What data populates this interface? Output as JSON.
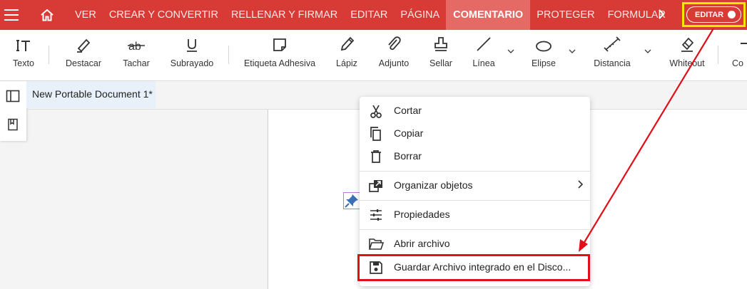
{
  "nav": {
    "items": [
      "VER",
      "CREAR Y CONVERTIR",
      "RELLENAR Y FIRMAR",
      "EDITAR",
      "PÁGINA",
      "COMENTARIO",
      "PROTEGER",
      "FORMULAR"
    ],
    "active": "COMENTARIO",
    "edit_toggle_label": "EDITAR",
    "colors": {
      "bar": "#d83a36",
      "active_tab": "#e56a66",
      "highlight": "#f3e600",
      "annotation": "#e0101a"
    }
  },
  "toolbar": {
    "tools": [
      {
        "label": "Texto",
        "icon": "text-tool-icon"
      },
      {
        "label": "Destacar",
        "icon": "highlighter-icon"
      },
      {
        "label": "Tachar",
        "icon": "strikethrough-icon"
      },
      {
        "label": "Subrayado",
        "icon": "underline-icon"
      },
      {
        "label": "Etiqueta Adhesiva",
        "icon": "sticky-note-icon"
      },
      {
        "label": "Lápiz",
        "icon": "pencil-icon"
      },
      {
        "label": "Adjunto",
        "icon": "paperclip-icon"
      },
      {
        "label": "Sellar",
        "icon": "stamp-icon"
      },
      {
        "label": "Línea",
        "icon": "line-icon"
      },
      {
        "label": "Elipse",
        "icon": "ellipse-icon"
      },
      {
        "label": "Distancia",
        "icon": "distance-icon"
      },
      {
        "label": "Whiteout",
        "icon": "eraser-icon"
      },
      {
        "label": "Co",
        "icon": "partial-tool-icon"
      }
    ]
  },
  "document": {
    "tab_title": "New Portable Document 1*"
  },
  "context_menu": {
    "items": [
      {
        "label": "Cortar",
        "icon": "scissors-icon"
      },
      {
        "label": "Copiar",
        "icon": "copy-icon"
      },
      {
        "label": "Borrar",
        "icon": "trash-icon"
      },
      {
        "label": "Organizar objetos",
        "icon": "arrange-objects-icon",
        "submenu": true
      },
      {
        "label": "Propiedades",
        "icon": "properties-sliders-icon"
      },
      {
        "label": "Abrir archivo",
        "icon": "folder-open-icon"
      },
      {
        "label": "Guardar Archivo integrado en el Disco...",
        "icon": "save-disk-icon",
        "highlighted": true
      }
    ]
  }
}
